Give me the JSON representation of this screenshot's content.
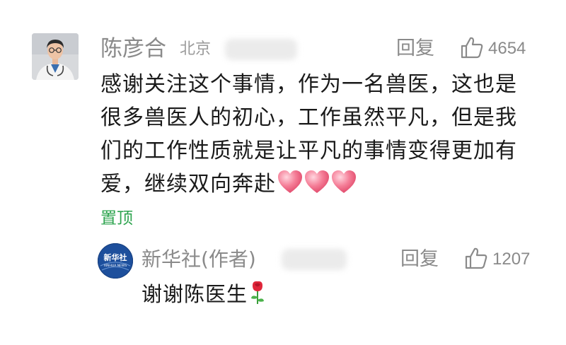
{
  "comment": {
    "author": "陈彦合",
    "location": "北京",
    "reply_label": "回复",
    "like_count": "4654",
    "text": "感谢关注这个事情，作为一名兽医，这也是很多兽医人的初心，工作虽然平凡，但是我们的工作性质就是让平凡的事情变得更加有爱，继续双向奔赴",
    "pinned_label": "置顶",
    "emoji": "heart-icon x3"
  },
  "reply": {
    "author": "新华社(作者)",
    "reply_label": "回复",
    "like_count": "1207",
    "text": "谢谢陈医生",
    "avatar_logo_text": "新华社",
    "avatar_logo_subtext": "XINHUA NEWS",
    "emoji": "rose-icon"
  },
  "colors": {
    "pinned_green": "#2ea44f",
    "meta_gray": "#8a8a8a",
    "text_black": "#1a1a1a",
    "heart_pink": "#f25a7a",
    "xinhua_blue": "#1d4f9c"
  }
}
